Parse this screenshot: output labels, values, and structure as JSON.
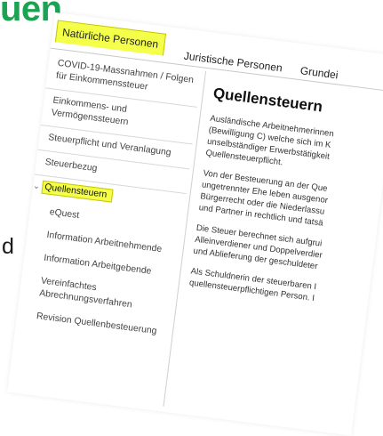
{
  "background": {
    "word": "uen",
    "letter": "d"
  },
  "tabs": [
    {
      "label": "Natürliche Personen",
      "active": true
    },
    {
      "label": "Juristische Personen",
      "active": false
    },
    {
      "label": "Grundei",
      "active": false
    }
  ],
  "sidebar": {
    "items": [
      {
        "label": "COVID-19-Massnahmen / Folgen für Einkommenssteuer"
      },
      {
        "label": "Einkommens- und Vermögenssteuern"
      },
      {
        "label": "Steuerpflicht und Veranlagung"
      },
      {
        "label": "Steuerbezug"
      },
      {
        "label": "Quellensteuern",
        "active": true
      },
      {
        "label": "eQuest"
      },
      {
        "label": "Information Arbeitnehmende"
      },
      {
        "label": "Information Arbeitgebende"
      },
      {
        "label": "Vereinfachtes Abrechnungsverfahren"
      },
      {
        "label": "Revision Quellenbesteuerung"
      }
    ]
  },
  "content": {
    "title": "Quellensteuern",
    "paragraphs": [
      [
        "Ausländische Arbeitnehmerinnen",
        "(Bewilligung C) welche sich im K",
        "unselbständiger Erwerbstätigkeit",
        "Quellensteuerpflicht."
      ],
      [
        "Von der Besteuerung an der Que",
        "ungetrennter Ehe leben ausgenor",
        "Bürgerrecht oder die Niederlassu",
        "und Partner in rechtlich und tatsä"
      ],
      [
        "Die Steuer berechnet sich aufgrui",
        "Alleinverdiener und Doppelverdier",
        "und Ablieferung der geschuldeter"
      ],
      [
        "Als Schuldnerin der steuerbaren I",
        "quellensteuerpflichtigen Person. I"
      ]
    ]
  },
  "colors": {
    "brand_green": "#1aa352",
    "highlight_yellow": "#f4ff4a"
  }
}
